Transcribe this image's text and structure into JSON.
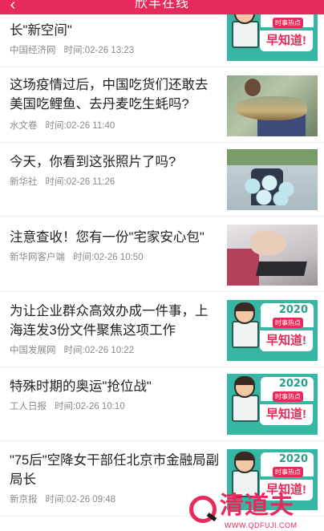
{
  "header": {
    "title": "欣丰在线",
    "back_icon": "chevron-left-icon",
    "background": "#e8295b"
  },
  "promo_thumb": {
    "year": "2020",
    "sub": "时事热点",
    "big": "早知道!"
  },
  "articles": [
    {
      "headline": "长\"新空间\"",
      "source": "中国经济网",
      "time_label": "时间:",
      "time": "02-26 13:23",
      "thumb": "promo"
    },
    {
      "headline": "这场疫情过后，中国吃货们还敢去美国吃鲤鱼、去丹麦吃生蚝吗?",
      "source": "水文卷",
      "time_label": "时间:",
      "time": "02-26 11:40",
      "thumb": "photo-fish"
    },
    {
      "headline": "今天，你看到这张照片了吗?",
      "source": "新华社",
      "time_label": "时间:",
      "time": "02-26 11:26",
      "thumb": "photo-masks"
    },
    {
      "headline": "注意查收！您有一份\"宅家安心包\"",
      "source": "新华网客户端",
      "time_label": "时间:",
      "time": "02-26 10:50",
      "thumb": "photo-desk"
    },
    {
      "headline": "为让企业群众高效办成一件事，上海连发3份文件聚焦这项工作",
      "source": "中国发展网",
      "time_label": "时间:",
      "time": "02-26 10:22",
      "thumb": "promo"
    },
    {
      "headline": "特殊时期的奥运\"抢位战\"",
      "source": "工人日报",
      "time_label": "时间:",
      "time": "02-26 10:10",
      "thumb": "promo"
    },
    {
      "headline": "\"75后\"空降女干部任北京市金融局副局长",
      "source": "新京报",
      "time_label": "时间:",
      "time": "02-26 09:48",
      "thumb": "promo"
    }
  ],
  "watermark": {
    "brand": "清道夫",
    "url": "WWW.QDFUJI.COM"
  }
}
